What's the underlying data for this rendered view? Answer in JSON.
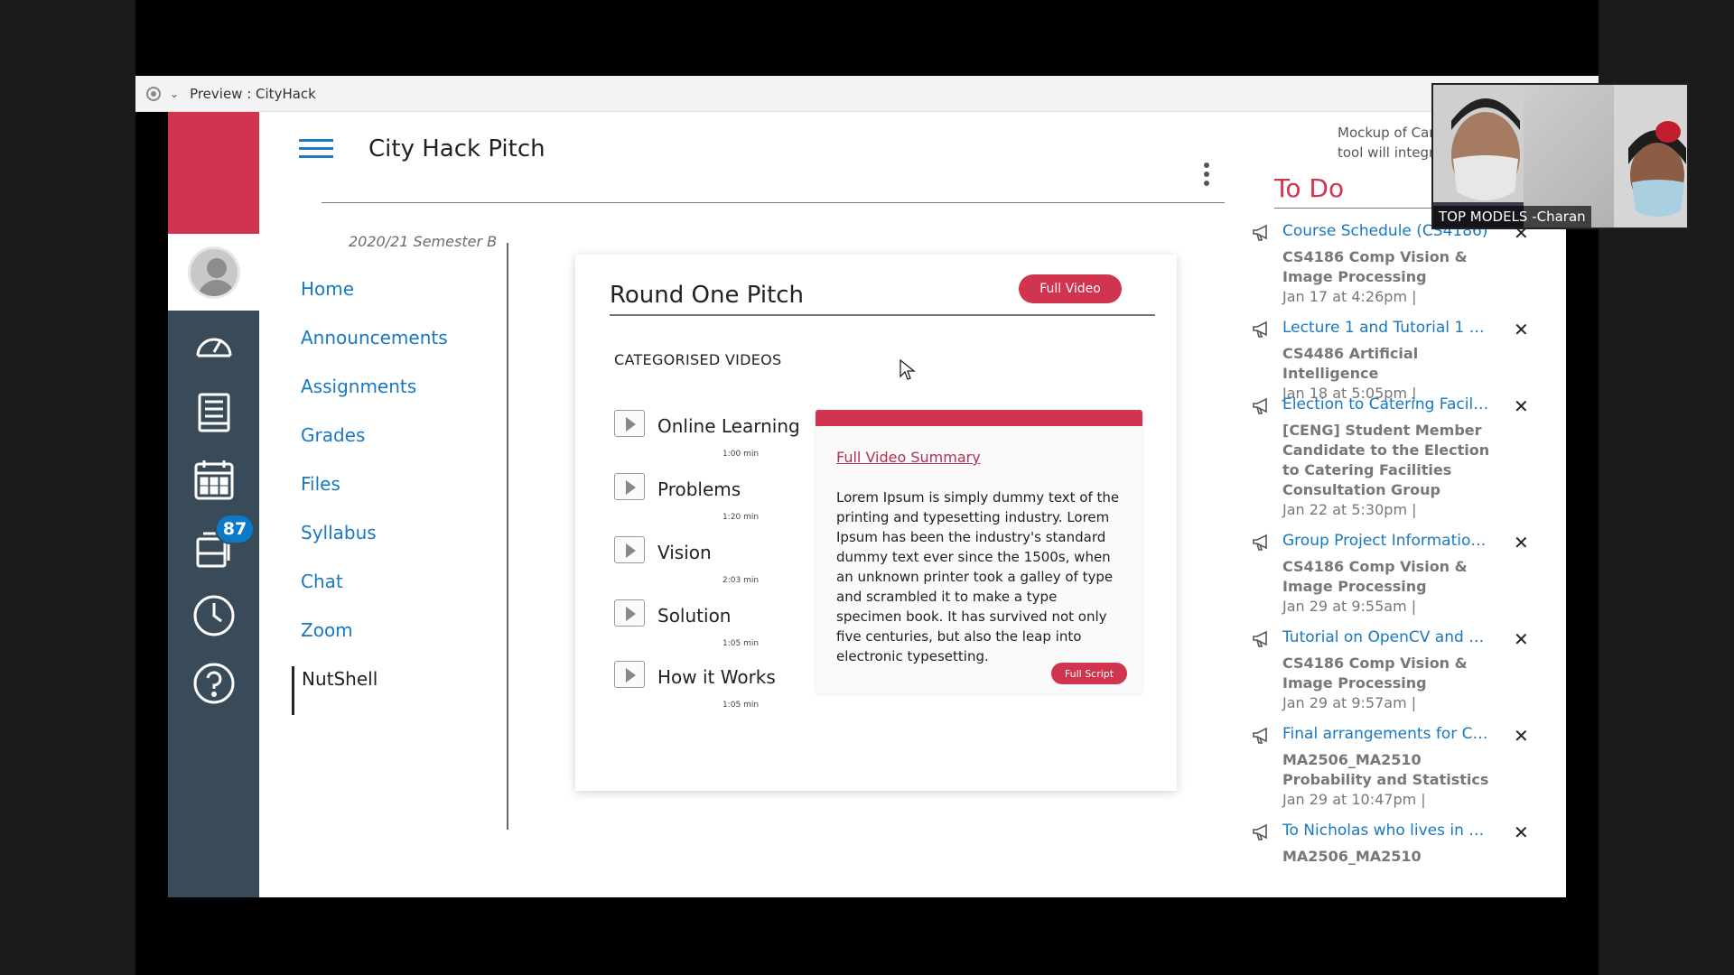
{
  "window": {
    "title": "Preview : CityHack"
  },
  "header": {
    "title": "City Hack Pitch"
  },
  "semester": "2020/21 Semester B",
  "rail": {
    "badge_count": "87"
  },
  "nav": {
    "items": [
      {
        "label": "Home"
      },
      {
        "label": "Announcements"
      },
      {
        "label": "Assignments"
      },
      {
        "label": "Grades"
      },
      {
        "label": "Files"
      },
      {
        "label": "Syllabus"
      },
      {
        "label": "Chat"
      },
      {
        "label": "Zoom"
      },
      {
        "label": "NutShell",
        "active": true
      }
    ]
  },
  "card": {
    "title": "Round One Pitch",
    "full_video_label": "Full Video",
    "section_label": "CATEGORISED VIDEOS",
    "videos": [
      {
        "title": "Online Learning",
        "duration": "1:00 min"
      },
      {
        "title": "Problems",
        "duration": "1:20 min"
      },
      {
        "title": "Vision",
        "duration": "2:03 min"
      },
      {
        "title": "Solution",
        "duration": "1:05 min"
      },
      {
        "title": "How it Works",
        "duration": "1:05 min"
      }
    ],
    "summary": {
      "link": "Full Video Summary",
      "body": "Lorem Ipsum is simply dummy text of the printing and typesetting industry. Lorem Ipsum has been the industry's standard dummy text ever since the 1500s, when an unknown printer took a galley of type and scrambled it to make a type specimen book. It has survived not only five centuries, but also the leap into electronic typesetting.",
      "full_script_label": "Full Script"
    }
  },
  "todo": {
    "mockup_note_line1": "Mockup of Car",
    "mockup_note_line2": "tool will integra",
    "title": "To Do",
    "items": [
      {
        "title": "Course Schedule (CS4186)",
        "course": "CS4186 Comp Vision & Image Processing",
        "date": "Jan 17 at 4:26pm  |"
      },
      {
        "title": "Lecture 1 and Tutorial 1 re...",
        "course": "CS4486 Artificial Intelligence",
        "date": "Jan 18 at 5:05pm  |"
      },
      {
        "title": "Election to Catering Faciliti...",
        "course": "[CENG] Student Member Candidate to the Election to Catering Facilities Consultation Group",
        "date": "Jan 22 at 5:30pm  |"
      },
      {
        "title": "Group Project Information ...",
        "course": "CS4186 Comp Vision & Image Processing",
        "date": "Jan 29 at 9:55am  |"
      },
      {
        "title": "Tutorial on OpenCV and Py...",
        "course": "CS4186 Comp Vision & Image Processing",
        "date": "Jan 29 at 9:57am  |"
      },
      {
        "title": "Final arrangements for Cla...",
        "course": "MA2506_MA2510 Probability and Statistics",
        "date": "Jan 29 at 10:47pm  |"
      },
      {
        "title": "To Nicholas who lives in So...",
        "course": "MA2506_MA2510",
        "date": ""
      }
    ]
  },
  "video_call": {
    "participant_label": "TOP MODELS -Charan"
  },
  "colors": {
    "accent": "#d0344f",
    "link": "#1878c1",
    "rail": "#394b59",
    "badge": "#0b7ac9"
  }
}
